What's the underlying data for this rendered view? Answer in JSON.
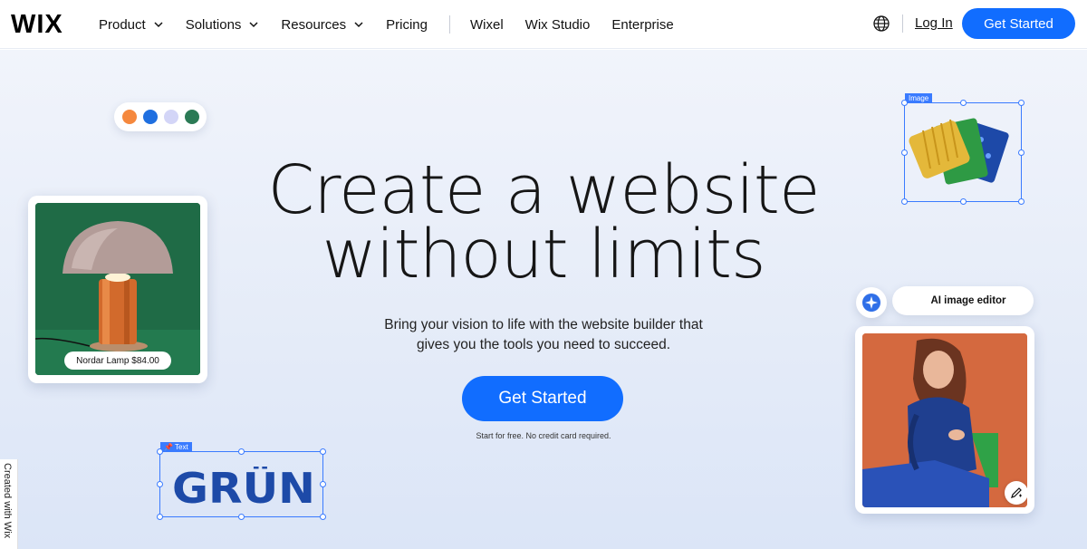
{
  "nav": {
    "logo": "WIX",
    "items": [
      {
        "label": "Product",
        "dropdown": true
      },
      {
        "label": "Solutions",
        "dropdown": true
      },
      {
        "label": "Resources",
        "dropdown": true
      },
      {
        "label": "Pricing",
        "dropdown": false
      }
    ],
    "secondary": [
      "Wixel",
      "Wix Studio",
      "Enterprise"
    ],
    "login": "Log In",
    "cta": "Get Started",
    "language_icon": "globe-icon"
  },
  "hero": {
    "headline_line1": "Create a website",
    "headline_line2": "without limits",
    "subtitle_line1": "Bring your vision to life with the website builder that",
    "subtitle_line2": "gives you the tools you need to succeed.",
    "cta": "Get Started",
    "note": "Start for free. No credit card required."
  },
  "palette": {
    "colors": [
      "#f5883d",
      "#1f6fe0",
      "#d3d5f7",
      "#2b7a55"
    ]
  },
  "lamp_card": {
    "price_tag": "Nordar Lamp $84.00"
  },
  "image_element": {
    "tag": "Image"
  },
  "ai_editor": {
    "label": "AI image editor"
  },
  "text_element": {
    "tag": "Text",
    "content": "GRÜN"
  },
  "badge": {
    "label": "Created with Wix"
  },
  "colors": {
    "accent": "#116dff",
    "selection": "#3a7bff"
  }
}
